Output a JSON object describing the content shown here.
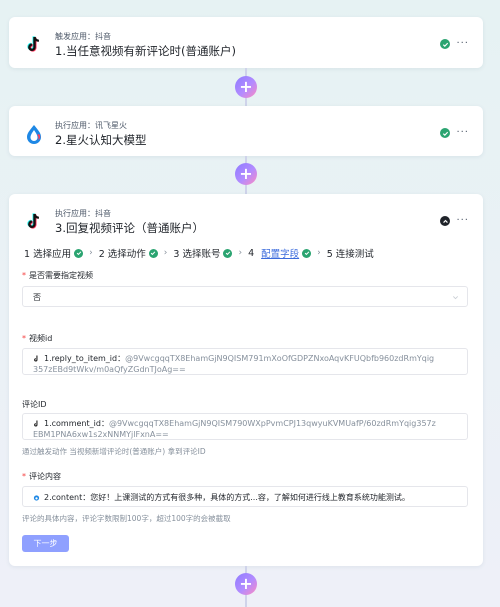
{
  "steps": [
    {
      "sub": "触发应用：抖音",
      "title": "1.当任意视频有新评论时(普通账户)"
    },
    {
      "sub": "执行应用：讯飞星火",
      "title": "2.星火认知大模型"
    },
    {
      "sub": "执行应用：抖音",
      "title": "3.回复视频评论（普通账户）"
    }
  ],
  "more_label": "···",
  "plus_label": "+",
  "tabs": [
    {
      "label": "1 选择应用"
    },
    {
      "label": "2 选择动作"
    },
    {
      "label": "3 选择账号"
    },
    {
      "label": "4"
    },
    {
      "label": "配置字段"
    },
    {
      "label": "5 连接测试"
    }
  ],
  "separator": "›",
  "form": {
    "specify_video": {
      "label": "是否需要指定视频",
      "value": "否"
    },
    "video_id": {
      "label": "视频id",
      "var_name": "1.reply_to_item_id",
      "var_value": "@9VwcgqqTX8EhamGjN9QISM791mXoOfGDPZNxoAqvKFUQbfb960zdRmYqig357zEBd9tWkv/m0aQfyZGdnTJoAg=="
    },
    "comment_id": {
      "label": "评论ID",
      "var_name": "1.comment_id",
      "var_value": "@9VwcgqqTX8EhamGjN9QISM790WXpPvmCPJ13qwyuKVMUafP/60zdRmYqig357zEBM1PNA6xw1s2xNNMYjlFxnA==",
      "hint": "通过触发动作 当视频新增评论时(普通账户) 拿到评论ID"
    },
    "comment_content": {
      "label": "评论内容",
      "var_name": "2.content",
      "var_value": "您好！上课测试的方式有很多种，具体的方式...容，了解如何进行线上教育系统功能测试。",
      "hint": "评论的具体内容，评论字数限制100字，超过100字的会被截取"
    }
  },
  "next_button": "下一步",
  "colors": {
    "accent": "#3b6bdc",
    "success": "#2ba471",
    "required": "#f53f3f"
  }
}
